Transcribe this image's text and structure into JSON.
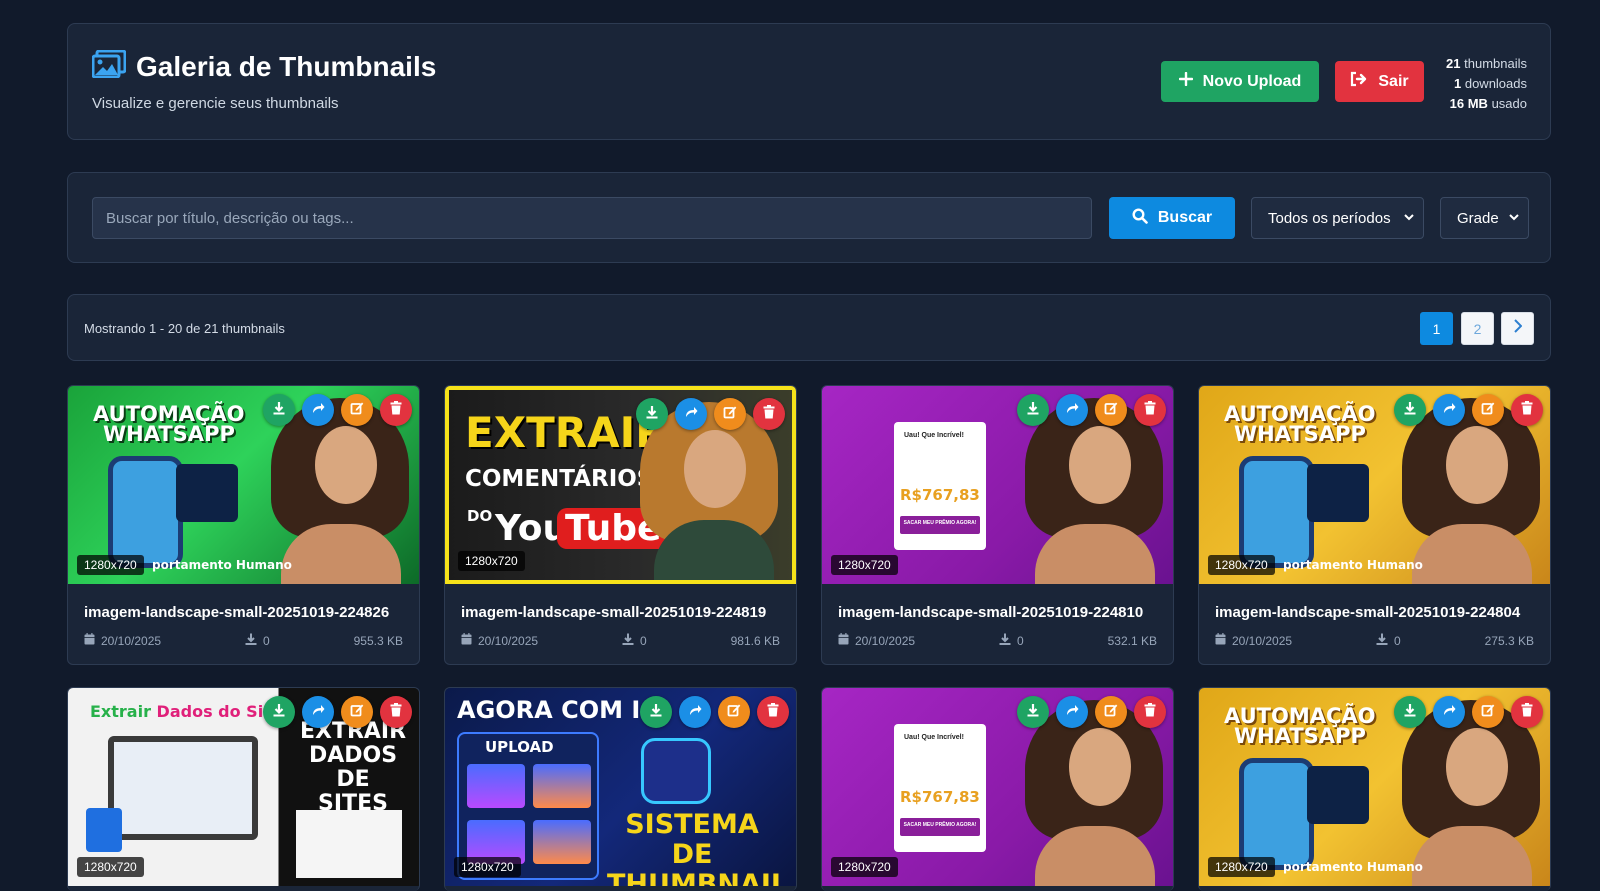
{
  "header": {
    "title": "Galeria de Thumbnails",
    "subtitle": "Visualize e gerencie seus thumbnails",
    "upload_label": "Novo Upload",
    "logout_label": "Sair",
    "stats": {
      "thumbnails_count": "21",
      "thumbnails_label": "thumbnails",
      "downloads_count": "1",
      "downloads_label": "downloads",
      "storage_value": "16 MB",
      "storage_label": "usado"
    }
  },
  "search": {
    "placeholder": "Buscar por título, descrição ou tags...",
    "value": "",
    "button_label": "Buscar",
    "period_selected": "Todos os períodos",
    "view_selected": "Grade"
  },
  "pagination": {
    "summary": "Mostrando 1 - 20 de 21 thumbnails",
    "pages": [
      "1",
      "2"
    ],
    "current": "1",
    "next_icon": "chevron-right-icon"
  },
  "cards": [
    {
      "title": "imagem-landscape-small-20251019-224826",
      "date": "20/10/2025",
      "downloads": "0",
      "size": "955.3 KB",
      "resolution": "1280x720",
      "art": {
        "line1": "AUTOMAÇÃO",
        "line2": "WHATSAPP",
        "footer": "portamento Humano"
      }
    },
    {
      "title": "imagem-landscape-small-20251019-224819",
      "date": "20/10/2025",
      "downloads": "0",
      "size": "981.6 KB",
      "resolution": "1280x720",
      "art": {
        "line1": "EXTRAIR",
        "line2": "COMENTÁRIOS",
        "line3": "DO",
        "you": "You",
        "tube": "Tube"
      }
    },
    {
      "title": "imagem-landscape-small-20251019-224810",
      "date": "20/10/2025",
      "downloads": "0",
      "size": "532.1 KB",
      "resolution": "1280x720",
      "art": {
        "head": "Uau! Que Incrível!",
        "value": "R$767,83",
        "cta": "SACAR MEU PRÊMIO AGORA!"
      }
    },
    {
      "title": "imagem-landscape-small-20251019-224804",
      "date": "20/10/2025",
      "downloads": "0",
      "size": "275.3 KB",
      "resolution": "1280x720",
      "art": {
        "line1": "AUTOMAÇÃO",
        "line2": "WHATSAPP",
        "footer": "portamento Humano"
      }
    },
    {
      "resolution": "1280x720",
      "art": {
        "line1": "Extrair",
        "line1b": "Dados do Site",
        "line2": "EXTRAIR",
        "line3": "DADOS",
        "line4": "DE SITES"
      }
    },
    {
      "resolution": "1280x720",
      "art": {
        "line1": "AGORA COM I",
        "upload": "UPLOAD",
        "line2": "SISTEMA DE",
        "line3": "THUMBNAIL"
      }
    },
    {
      "resolution": "1280x720",
      "art": {
        "head": "Uau! Que Incrível!",
        "value": "R$767,83",
        "cta": "SACAR MEU PRÊMIO AGORA!"
      }
    },
    {
      "resolution": "1280x720",
      "art": {
        "line1": "AUTOMAÇÃO",
        "line2": "WHATSAPP",
        "footer": "portamento Humano"
      }
    }
  ],
  "icons": {
    "logo": "images-icon",
    "plus": "plus-icon",
    "logout": "sign-out-icon",
    "search": "search-icon",
    "download": "download-icon",
    "share": "share-icon",
    "edit": "edit-icon",
    "delete": "trash-icon",
    "calendar": "calendar-icon"
  },
  "colors": {
    "background": "#111a2b",
    "panel": "#1a2538",
    "success": "#1fa463",
    "danger": "#e2333f",
    "primary": "#0d8ae0",
    "share": "#1b8fe6",
    "warning": "#f08c1c"
  }
}
